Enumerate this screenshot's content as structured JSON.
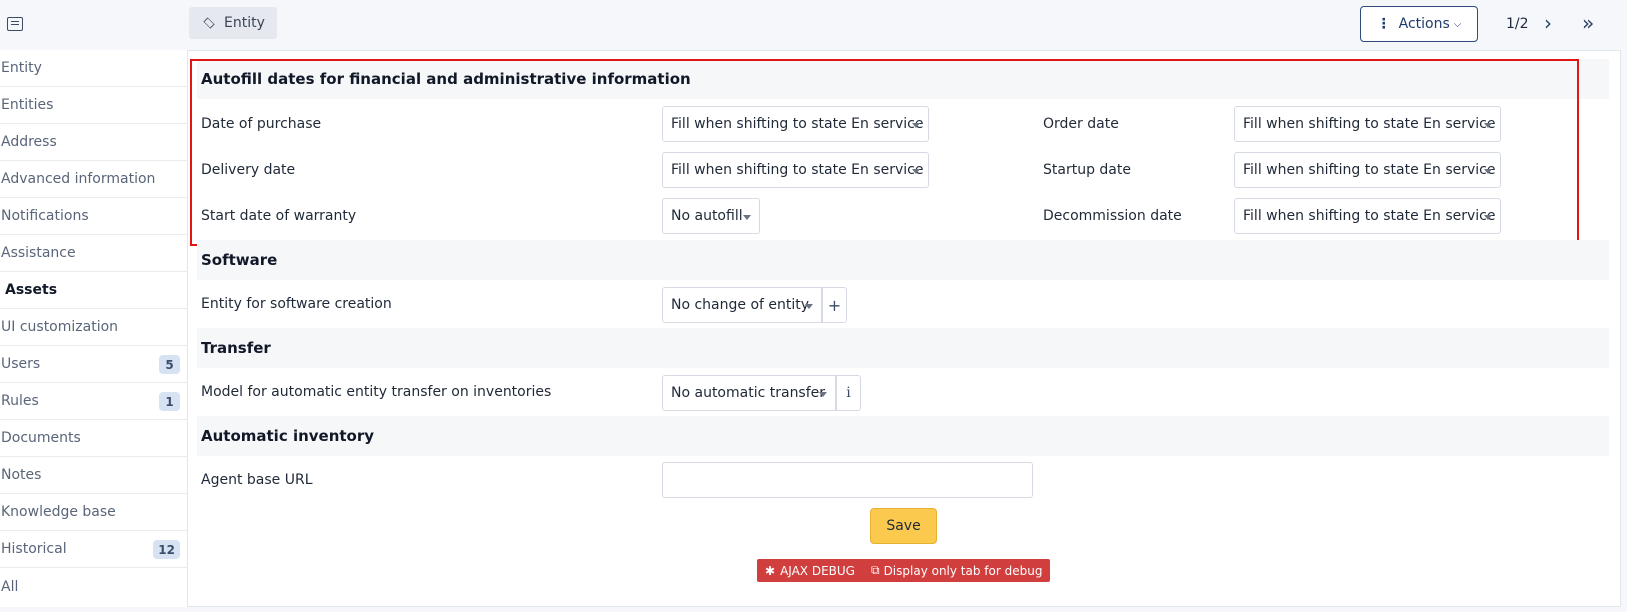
{
  "header": {
    "tab_label": "Entity",
    "actions_label": "Actions",
    "pager": "1/2"
  },
  "sidebar": {
    "items": [
      {
        "label": "Entity"
      },
      {
        "label": "Entities"
      },
      {
        "label": "Address"
      },
      {
        "label": "Advanced information"
      },
      {
        "label": "Notifications"
      },
      {
        "label": "Assistance"
      },
      {
        "label": "Assets",
        "active": true
      },
      {
        "label": "UI customization"
      },
      {
        "label": "Users",
        "badge": "5"
      },
      {
        "label": "Rules",
        "badge": "1"
      },
      {
        "label": "Documents"
      },
      {
        "label": "Notes"
      },
      {
        "label": "Knowledge base"
      },
      {
        "label": "Historical",
        "badge": "12"
      },
      {
        "label": "All"
      }
    ]
  },
  "autofill": {
    "title": "Autofill dates for financial and administrative information",
    "date_of_purchase_label": "Date of purchase",
    "date_of_purchase_value": "Fill when shifting to state En service",
    "order_date_label": "Order date",
    "order_date_value": "Fill when shifting to state En service",
    "delivery_date_label": "Delivery date",
    "delivery_date_value": "Fill when shifting to state En service",
    "startup_date_label": "Startup date",
    "startup_date_value": "Fill when shifting to state En service",
    "warranty_label": "Start date of warranty",
    "warranty_value": "No autofill",
    "decommission_label": "Decommission date",
    "decommission_value": "Fill when shifting to state En service"
  },
  "software": {
    "title": "Software",
    "entity_label": "Entity for software creation",
    "entity_value": "No change of entity"
  },
  "transfer": {
    "title": "Transfer",
    "model_label": "Model for automatic entity transfer on inventories",
    "model_value": "No automatic transfer"
  },
  "inventory": {
    "title": "Automatic inventory",
    "agent_url_label": "Agent base URL",
    "agent_url_value": ""
  },
  "footer": {
    "save_label": "Save",
    "ajax_debug_label": "AJAX DEBUG",
    "display_tab_label": "Display only tab for debug"
  },
  "colors": {
    "accent": "#2f4b7c",
    "save": "#fcc94f",
    "debug": "#d13e3e",
    "highlight": "#e21515"
  }
}
